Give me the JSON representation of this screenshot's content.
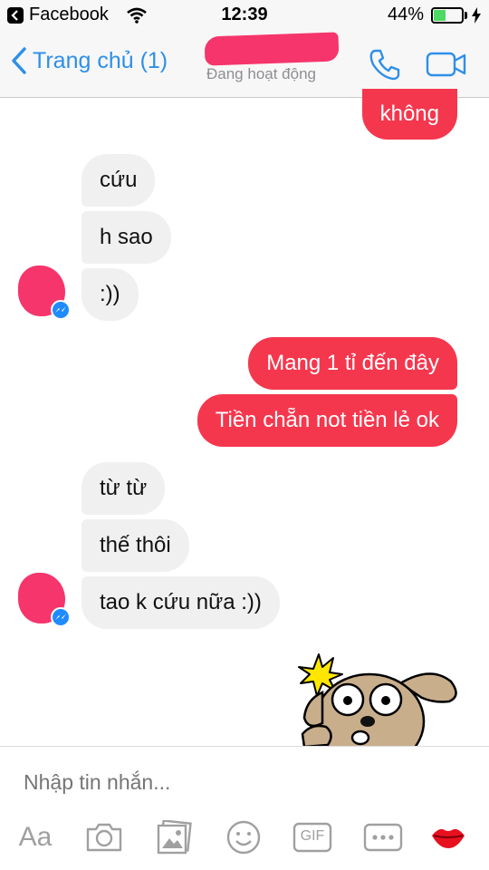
{
  "status_bar": {
    "app": "Facebook",
    "time": "12:39",
    "battery": "44%",
    "battery_level": 0.44
  },
  "nav": {
    "back_label": "Trang chủ (1)",
    "status": "Đang hoạt động"
  },
  "messages": [
    {
      "side": "out",
      "text": "không"
    },
    {
      "side": "in",
      "text": "cứu"
    },
    {
      "side": "in",
      "text": "h sao"
    },
    {
      "side": "in",
      "text": ":))"
    },
    {
      "side": "out",
      "text": "Mang 1 tỉ đến đây"
    },
    {
      "side": "out",
      "text": "Tiền chẵn not tiền lẻ ok"
    },
    {
      "side": "in",
      "text": "từ từ"
    },
    {
      "side": "in",
      "text": "thế thôi"
    },
    {
      "side": "in",
      "text": "tao k cứu nữa :))"
    }
  ],
  "composer": {
    "placeholder": "Nhập tin nhắn...",
    "aa_label": "Aa",
    "gif_label": "GIF"
  },
  "colors": {
    "accent": "#2e8fe8",
    "outgoing_bubble": "#f5374e",
    "incoming_bubble": "#f0f0f0",
    "messenger_badge": "#1f8bff"
  },
  "icons": [
    "back-chevron-icon",
    "phone-icon",
    "video-camera-icon",
    "camera-icon",
    "gallery-icon",
    "emoji-icon",
    "gif-icon",
    "more-icon",
    "lips-icon",
    "messenger-badge-icon"
  ]
}
